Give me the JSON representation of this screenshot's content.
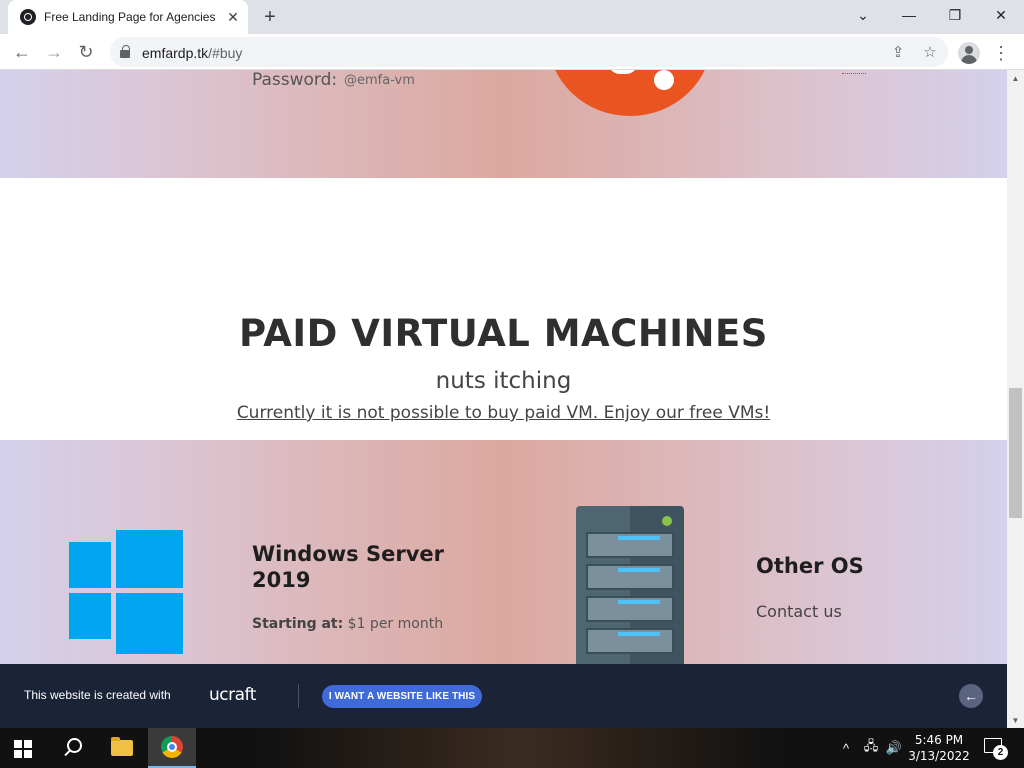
{
  "browser": {
    "tab_title": "Free Landing Page for Agencies",
    "tab_close": "✕",
    "new_tab": "+",
    "url_host": "emfardp.tk",
    "url_path": "/#buy",
    "window_controls": {
      "minimize": "—",
      "maximize": "❐",
      "close": "✕",
      "tablist": "⌄"
    },
    "nav": {
      "back": "←",
      "forward": "→",
      "reload": "↻"
    },
    "omnibox_icons": {
      "share": "⇪",
      "bookmark": "☆"
    },
    "menu": "⋮"
  },
  "page": {
    "password_label": "Password:",
    "password_value": "@emfa-vm",
    "paid_section": {
      "title": "PAID VIRTUAL MACHINES",
      "subtitle": "nuts itching",
      "link_text": "Currently it is not possible to buy paid VM. Enjoy our free VMs!"
    },
    "cards": [
      {
        "title": "Windows Server 2019",
        "price_label": "Starting at:",
        "price_value": "$1 per month"
      },
      {
        "title": "Other OS",
        "action": "Contact us"
      }
    ],
    "colors": {
      "accent_orange": "#e95420",
      "windows_blue": "#00a4ef",
      "banner_bg": "#1b2337",
      "cta_blue": "#3f6ad8"
    }
  },
  "banner": {
    "text": "This website is created with",
    "brand": "ucraft",
    "cta": "I WANT A WEBSITE LIKE THIS",
    "arrow": "←"
  },
  "taskbar": {
    "time": "5:46 PM",
    "date": "3/13/2022",
    "notification_count": "2",
    "tray": {
      "chevron": "^",
      "network": "🖧",
      "volume": "🔊"
    }
  }
}
